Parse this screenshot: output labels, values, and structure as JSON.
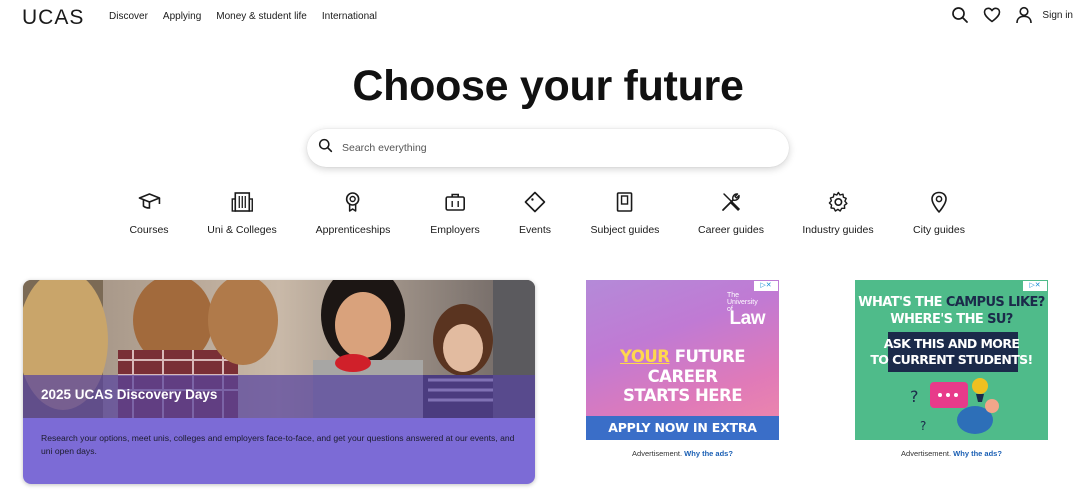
{
  "header": {
    "logo": "UCAS",
    "nav": [
      "Discover",
      "Applying",
      "Money & student life",
      "International"
    ],
    "icons": [
      "search-icon",
      "heart-icon",
      "user-icon"
    ],
    "signin": "Sign in"
  },
  "hero": {
    "title": "Choose your future",
    "search_placeholder": "Search everything"
  },
  "categories": [
    {
      "label": "Courses",
      "icon": "mortarboard-icon"
    },
    {
      "label": "Uni & Colleges",
      "icon": "building-icon"
    },
    {
      "label": "Apprenticeships",
      "icon": "rosette-icon"
    },
    {
      "label": "Employers",
      "icon": "briefcase-icon"
    },
    {
      "label": "Events",
      "icon": "ticket-icon"
    },
    {
      "label": "Subject guides",
      "icon": "book-icon"
    },
    {
      "label": "Career guides",
      "icon": "tools-icon"
    },
    {
      "label": "Industry guides",
      "icon": "gear-icon"
    },
    {
      "label": "City guides",
      "icon": "map-pin-icon"
    }
  ],
  "feature": {
    "title": "2025 UCAS Discovery Days",
    "description": "Research your options, meet unis, colleges and employers face-to-face, and get your questions answered at our events, and uni open days."
  },
  "ads": [
    {
      "brand_small": "The University of",
      "brand": "Law",
      "line1_a": "YOUR",
      "line1_b": " FUTURE",
      "line2": "CAREER",
      "line3": "STARTS HERE",
      "cta": "APPLY NOW IN EXTRA",
      "note": "Advertisement.",
      "why": "Why the ads?"
    },
    {
      "line1_a": "WHAT'S THE ",
      "line1_b": "CAMPUS LIKE?",
      "line2_a": "WHERE'S THE ",
      "line2_b": "SU?",
      "line3": "ASK THIS AND MORE",
      "line4": "TO CURRENT STUDENTS!",
      "note": "Advertisement.",
      "why": "Why the ads?"
    }
  ],
  "colors": {
    "card_band": "#5844a0",
    "card_body": "#7c6bd6",
    "ad2_bg": "#4fbb8a",
    "ad1_bar": "#3a6ec8"
  }
}
